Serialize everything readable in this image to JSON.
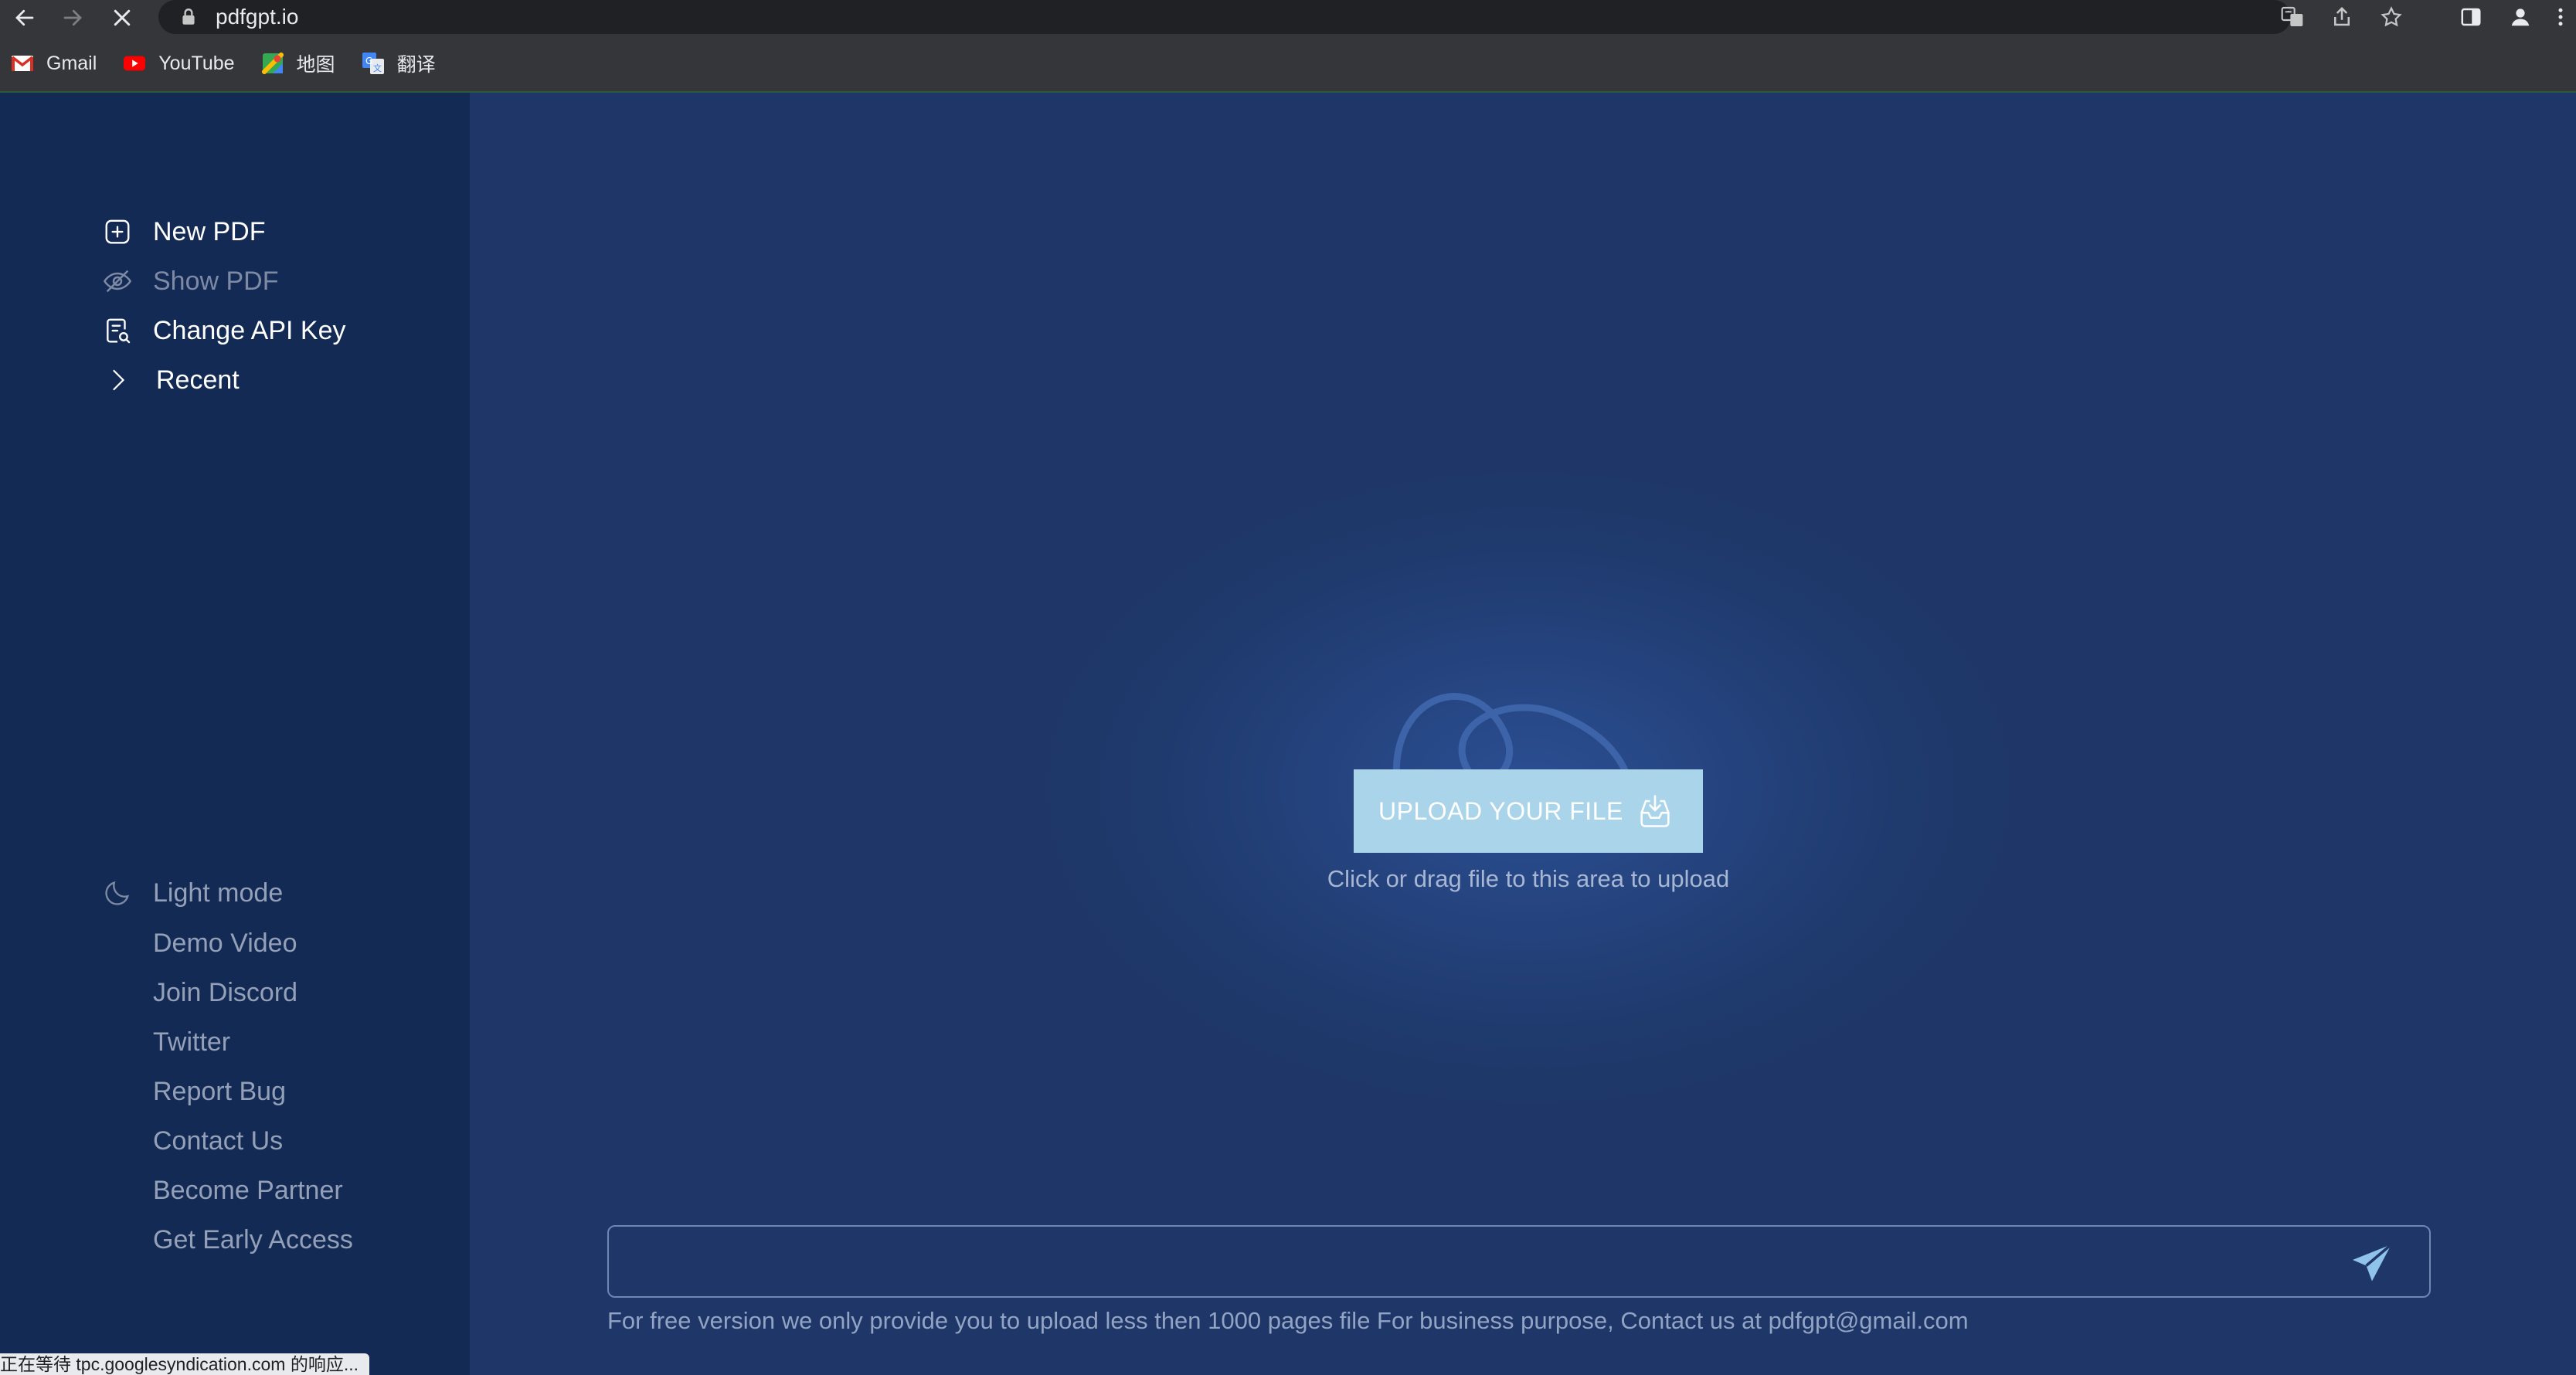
{
  "browser": {
    "url": "pdfgpt.io",
    "bookmarks": [
      {
        "label": "Gmail",
        "icon": "gmail-icon"
      },
      {
        "label": "YouTube",
        "icon": "youtube-icon"
      },
      {
        "label": "地图",
        "icon": "maps-icon"
      },
      {
        "label": "翻译",
        "icon": "translate-icon"
      }
    ],
    "status_text": "正在等待 tpc.googlesyndication.com 的响应..."
  },
  "sidebar": {
    "menu": [
      {
        "label": "New PDF",
        "icon": "plus-square-icon"
      },
      {
        "label": "Show PDF",
        "icon": "eye-off-icon"
      },
      {
        "label": "Change API Key",
        "icon": "document-search-icon"
      },
      {
        "label": "Recent",
        "icon": "chevron-right-icon"
      }
    ],
    "theme_toggle": {
      "label": "Light mode",
      "icon": "moon-icon"
    },
    "links": [
      "Demo Video",
      "Join Discord",
      "Twitter",
      "Report Bug",
      "Contact Us",
      "Become Partner",
      "Get Early Access"
    ]
  },
  "main": {
    "upload_label": "UPLOAD YOUR FILE",
    "upload_hint": "Click or drag file to this area to upload",
    "chat_placeholder": "",
    "notice": "For free version we only provide you to upload less then 1000 pages file For business purpose, Contact us at pdfgpt@gmail.com"
  },
  "colors": {
    "sidebar_bg": "#132a55",
    "main_bg": "#1e3768",
    "upload_button": "#a9d4ea",
    "send_icon": "#8fc3ea"
  }
}
